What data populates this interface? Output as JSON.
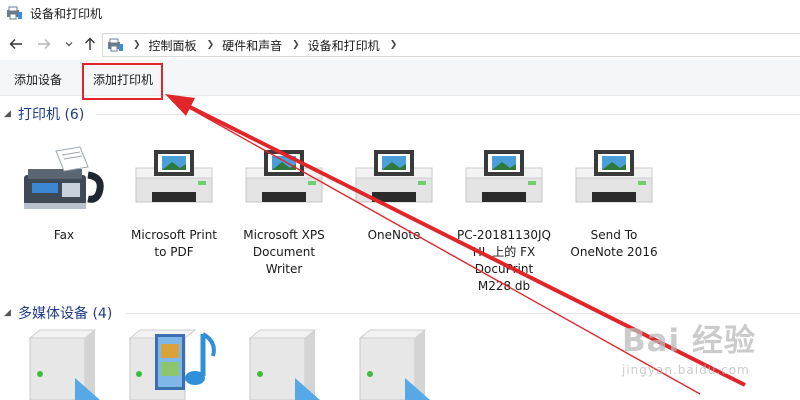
{
  "window": {
    "title": "设备和打印机"
  },
  "nav": {
    "back_icon": "back-arrow-icon",
    "forward_icon": "forward-arrow-icon",
    "recent_icon": "chevron-down-icon",
    "up_icon": "up-arrow-icon"
  },
  "address": {
    "crumbs": [
      "控制面板",
      "硬件和声音",
      "设备和打印机"
    ]
  },
  "commands": {
    "add_device": "添加设备",
    "add_printer": "添加打印机"
  },
  "groups": {
    "printers": {
      "title": "打印机 (6)",
      "items": [
        {
          "label": "Fax",
          "icon": "fax-icon"
        },
        {
          "label": "Microsoft Print\nto PDF",
          "icon": "printer-icon"
        },
        {
          "label": "Microsoft XPS\nDocument\nWriter",
          "icon": "printer-icon"
        },
        {
          "label": "OneNote",
          "icon": "printer-icon"
        },
        {
          "label": "PC-20181130JQ\nHL 上的 FX\nDocuPrint\nM228 db",
          "icon": "printer-icon"
        },
        {
          "label": "Send To\nOneNote 2016",
          "icon": "printer-icon"
        }
      ]
    },
    "multimedia": {
      "title": "多媒体设备 (4)",
      "items": [
        {
          "icon": "media-server-icon"
        },
        {
          "icon": "media-library-icon"
        },
        {
          "icon": "media-server-icon"
        },
        {
          "icon": "media-server-icon"
        }
      ]
    }
  },
  "annotation": {
    "color": "#e0262b"
  },
  "watermark": {
    "main": "Bai 经验",
    "sub": "jingyan.baidu.com"
  }
}
